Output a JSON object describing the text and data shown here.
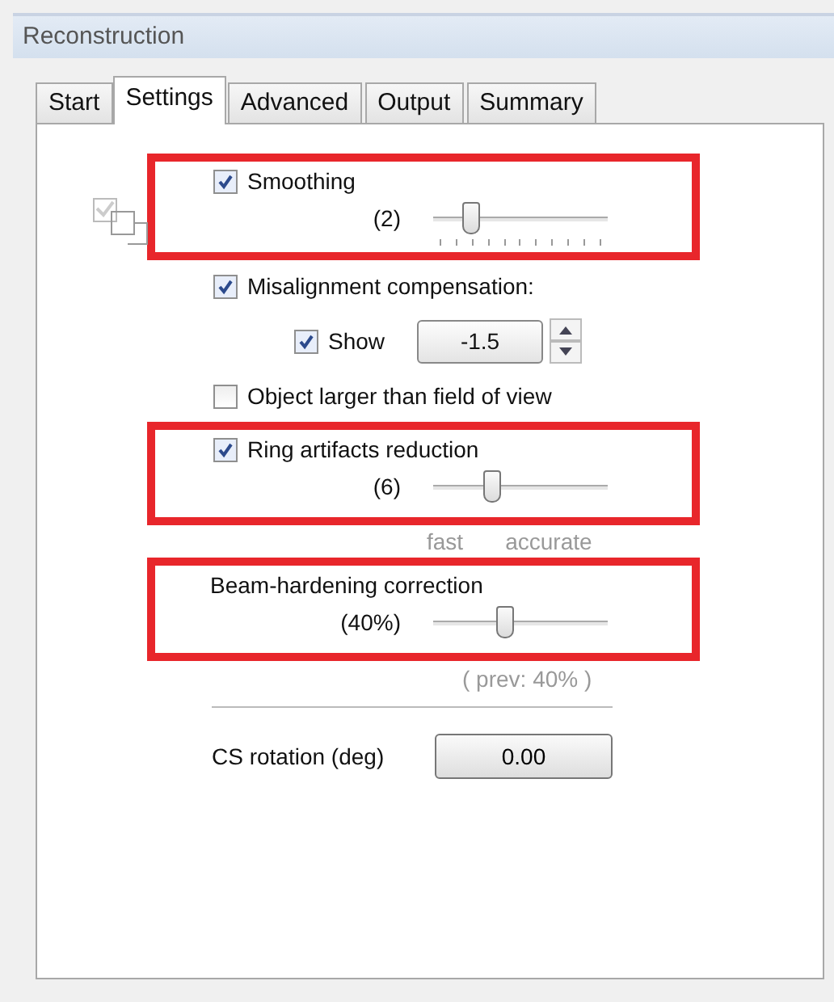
{
  "window": {
    "title": "Reconstruction"
  },
  "tabs": [
    {
      "label": "Start",
      "selected": false
    },
    {
      "label": "Settings",
      "selected": true
    },
    {
      "label": "Advanced",
      "selected": false
    },
    {
      "label": "Output",
      "selected": false
    },
    {
      "label": "Summary",
      "selected": false
    }
  ],
  "settings": [
    {
      "kind": "check-slider",
      "label": "Smoothing",
      "checked": true,
      "highlighted": true,
      "reading": "(2)",
      "level": 0.2,
      "ticked": true,
      "linked": true
    },
    {
      "kind": "check",
      "label": "Misalignment compensation:",
      "checked": true
    },
    {
      "kind": "spin",
      "label": "Show",
      "checked": true,
      "value": "-1.5"
    },
    {
      "kind": "check",
      "label": "Object larger than field of view",
      "checked": false
    },
    {
      "kind": "check-slider",
      "label": "Ring artifacts reduction",
      "checked": true,
      "highlighted": true,
      "reading": "(6)",
      "level": 0.32,
      "ticked": false
    },
    {
      "kind": "scale",
      "labels": [
        "fast",
        "accurate"
      ]
    },
    {
      "kind": "slider",
      "label": "Beam-hardening correction",
      "highlighted": true,
      "reading": "(40%)",
      "level": 0.4
    },
    {
      "kind": "note",
      "text": "( prev: 40% )"
    },
    {
      "kind": "divider"
    },
    {
      "kind": "button",
      "label": "CS rotation (deg)",
      "value": "0.00"
    }
  ]
}
